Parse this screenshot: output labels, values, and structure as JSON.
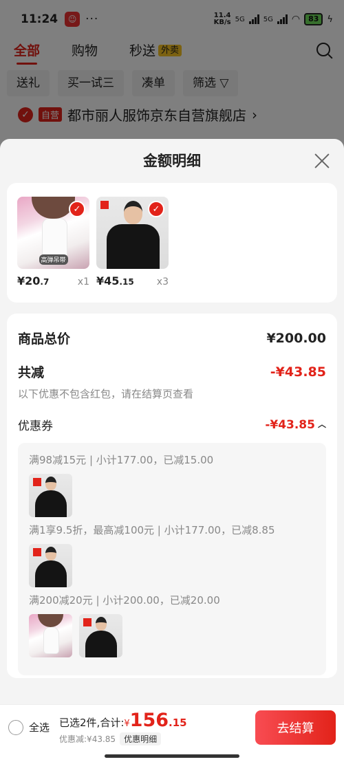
{
  "status_bar": {
    "time": "11:24",
    "dots": "···",
    "speed_top": "11.4",
    "speed_bottom": "KB/s",
    "net1": "5G",
    "net2": "5G",
    "battery": "83"
  },
  "tabs": {
    "all": "全部",
    "shopping": "购物",
    "flash": "秒送",
    "flash_badge": "外卖"
  },
  "filters": [
    "送礼",
    "买一试三",
    "凑单",
    "筛选"
  ],
  "shop": {
    "self_tag": "自营",
    "name": "都市丽人服饰京东自营旗舰店",
    "arrow": "›"
  },
  "sheet": {
    "title": "金额明细",
    "products": [
      {
        "price_int": "¥20",
        "price_dec": ".7",
        "qty": "x1",
        "tag": "高弹吊带"
      },
      {
        "price_int": "¥45",
        "price_dec": ".15",
        "qty": "x3"
      }
    ],
    "total_label": "商品总价",
    "total_value": "¥200.00",
    "reduce_label": "共减",
    "reduce_value": "-¥43.85",
    "note": "以下优惠不包含红包，请在结算页查看",
    "coupon_label": "优惠券",
    "coupon_value": "-¥43.85",
    "coupon_lines": [
      "满98减15元 | 小计177.00，已减15.00",
      "满1享9.5折，最高减100元 | 小计177.00，已减8.85",
      "满200减20元 | 小计200.00，已减20.00"
    ]
  },
  "bottom_bar": {
    "select_all": "全选",
    "selected": "已选2件,合计:",
    "yen": "¥",
    "total_int": "156",
    "total_dec": ".15",
    "discount": "优惠减:¥43.85",
    "detail_btn": "优惠明细",
    "checkout": "去结算"
  }
}
